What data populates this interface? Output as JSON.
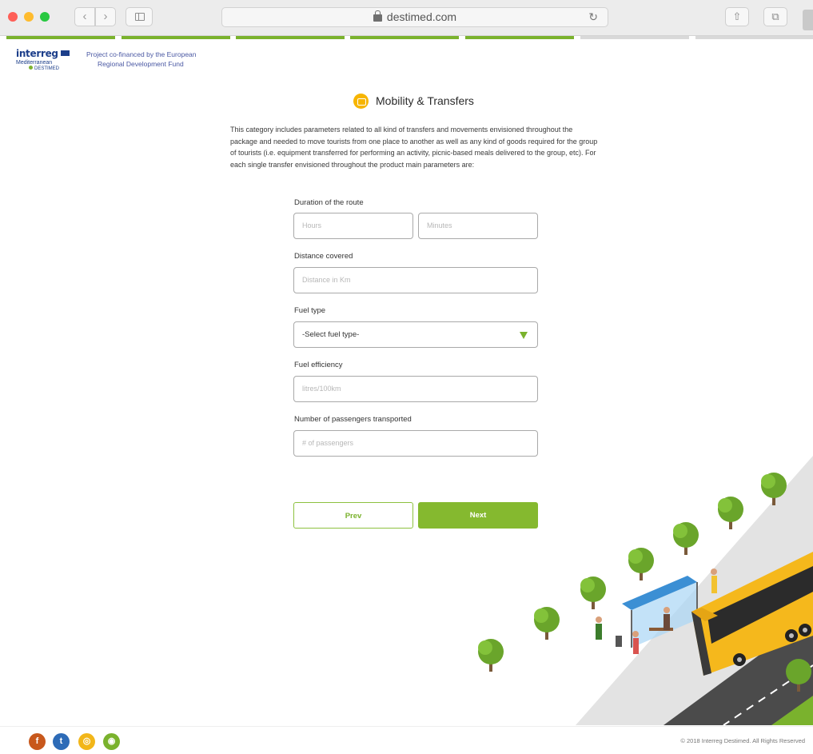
{
  "browser": {
    "url": "destimed.com",
    "nav_back": "‹",
    "nav_forward": "›",
    "reload": "↻",
    "share": "⇧",
    "tabs": "⧉"
  },
  "progress": {
    "segment_colors": [
      "#7ab22d",
      "#7ab22d",
      "#7ab22d",
      "#7ab22d",
      "#7ab22d",
      "#d9d9d9",
      "#d9d9d9"
    ]
  },
  "header": {
    "logo_word": "interreg",
    "logo_sub": "Mediterranean",
    "logo_sub2": "DESTIMED",
    "cofinance_line1": "Project co-financed by the European",
    "cofinance_line2": "Regional Development Fund"
  },
  "section": {
    "title": "Mobility & Transfers",
    "icon": "bus-icon",
    "intro": "This category includes parameters related to all kind of transfers and movements envisioned throughout the package and needed to move tourists from one place to another as well as any kind of goods required for the group of tourists (i.e. equipment transferred for performing an activity, picnic-based meals delivered to the group, etc). For each single transfer envisioned throughout the product main parameters are:"
  },
  "form": {
    "duration_label": "Duration of the route",
    "hours_placeholder": "Hours",
    "minutes_placeholder": "Minutes",
    "distance_label": "Distance covered",
    "distance_placeholder": "Distance in Km",
    "fuel_type_label": "Fuel type",
    "fuel_type_selected": "-Select fuel type-",
    "fuel_efficiency_label": "Fuel efficiency",
    "fuel_efficiency_placeholder": "litres/100km",
    "passengers_label": "Number of passengers transported",
    "passengers_placeholder": "# of passengers",
    "prev_label": "Prev",
    "next_label": "Next"
  },
  "footer": {
    "facebook": "f",
    "twitter": "t",
    "instagram": "◎",
    "rss": "◉",
    "copyright": "© 2018 Interreg Destimed. All Rights Reserved"
  },
  "colors": {
    "accent": "#7ab22d",
    "title_icon": "#f7b500",
    "bus": "#f5b81c"
  }
}
